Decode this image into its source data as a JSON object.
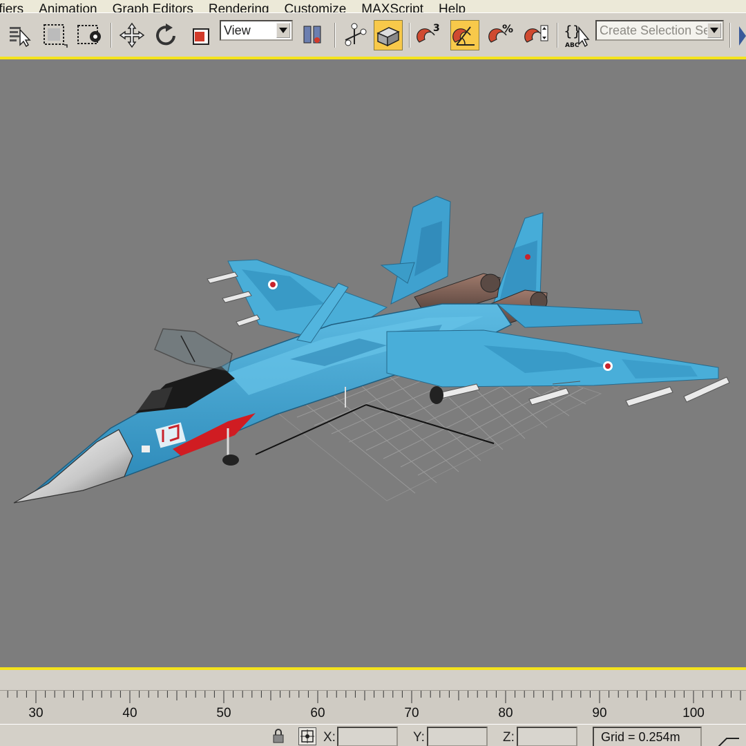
{
  "menu": {
    "items": [
      "ifiers",
      "Animation",
      "Graph Editors",
      "Rendering",
      "Customize",
      "MAXScript",
      "Help"
    ]
  },
  "toolbar": {
    "view_dropdown": "View",
    "selection_set_placeholder": "Create Selection Set",
    "snap_label": "3",
    "percent_label": "%",
    "abc_label": "ABC"
  },
  "timeline": {
    "ticks": [
      "30",
      "40",
      "50",
      "60",
      "70",
      "80",
      "90",
      "100"
    ]
  },
  "status": {
    "x_label": "X:",
    "y_label": "Y:",
    "z_label": "Z:",
    "grid_text": "Grid = 0.254m"
  },
  "colors": {
    "active_button": "#f8c94a",
    "viewport_border": "#f4e31c",
    "viewport_bg": "#7d7d7d",
    "jet_blue": "#3ea4cf"
  }
}
